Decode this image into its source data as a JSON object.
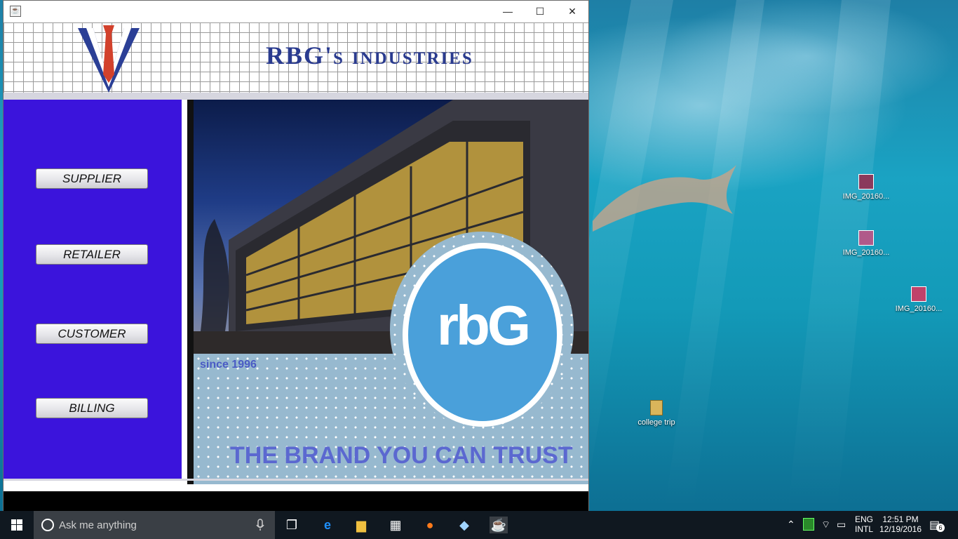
{
  "window": {
    "brand_title": "RBG's industries",
    "minimize": "—",
    "maximize": "☐",
    "close": "✕"
  },
  "sidebar": {
    "buttons": [
      {
        "label": "SUPPLIER"
      },
      {
        "label": "RETAILER"
      },
      {
        "label": "CUSTOMER"
      },
      {
        "label": "BILLING"
      }
    ]
  },
  "banner": {
    "since": "since 1996",
    "slogan": "THE BRAND YOU CAN TRUST",
    "logo_text": "rbG"
  },
  "desktop": {
    "icons": [
      {
        "label": "IMG_20160..."
      },
      {
        "label": "IMG_20160..."
      },
      {
        "label": "IMG_20160..."
      },
      {
        "label": "college trip"
      }
    ]
  },
  "taskbar": {
    "search_placeholder": "Ask me anything",
    "lang_top": "ENG",
    "lang_bottom": "INTL",
    "time": "12:51 PM",
    "date": "12/19/2016",
    "notifications": "6"
  },
  "colors": {
    "sidebar": "#3b14dc",
    "brand_title": "#2a3b8f",
    "slogan": "#5b68d0",
    "logo": "#4aa0da"
  }
}
